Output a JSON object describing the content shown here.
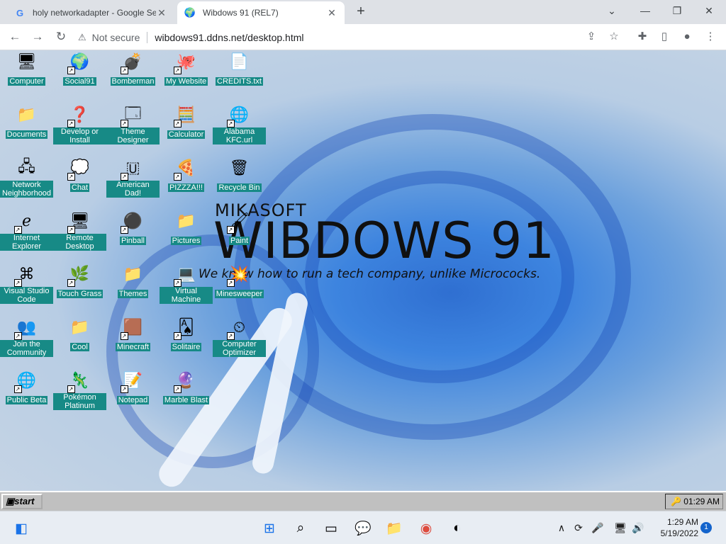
{
  "browser": {
    "tabs": [
      {
        "label": "holy networkadapter - Google Se",
        "icon": "google-icon",
        "active": false
      },
      {
        "label": "Wibdows 91 (REL7)",
        "icon": "globe-icon",
        "active": true
      }
    ],
    "security_label": "Not secure",
    "url": "wibdows91.ddns.net/desktop.html"
  },
  "desktop": {
    "brand_small": "MIKASOFT",
    "brand_large": "WIBDOWS 91",
    "tagline": "We know how to run a tech company, unlike Micrococks.",
    "icons": [
      {
        "label": "Computer",
        "icon": "computer-icon"
      },
      {
        "label": "Social91",
        "icon": "globe-icon"
      },
      {
        "label": "Bomberman",
        "icon": "bomberman-icon"
      },
      {
        "label": "My Website",
        "icon": "github-icon"
      },
      {
        "label": "CREDITS.txt",
        "icon": "text-file-icon"
      },
      {
        "label": "Documents",
        "icon": "folder-icon"
      },
      {
        "label": "Develop or Install",
        "icon": "help-icon"
      },
      {
        "label": "Theme Designer",
        "icon": "window-icon"
      },
      {
        "label": "Calculator",
        "icon": "calculator-icon"
      },
      {
        "label": "Alabama KFC.url",
        "icon": "internet-shortcut-icon"
      },
      {
        "label": "Network Neighborhood",
        "icon": "network-icon"
      },
      {
        "label": "Chat",
        "icon": "chat-bubble-icon"
      },
      {
        "label": "American Dad!",
        "icon": "flag-icon"
      },
      {
        "label": "PIZZZA!!!",
        "icon": "pizza-icon"
      },
      {
        "label": "Recycle Bin",
        "icon": "recycle-bin-icon"
      },
      {
        "label": "Internet Explorer",
        "icon": "internet-explorer-icon"
      },
      {
        "label": "Remote Desktop",
        "icon": "remote-desktop-icon"
      },
      {
        "label": "Pinball",
        "icon": "pinball-icon"
      },
      {
        "label": "Pictures",
        "icon": "folder-icon"
      },
      {
        "label": "Paint",
        "icon": "paint-icon"
      },
      {
        "label": "Visual Studio Code",
        "icon": "vscode-icon"
      },
      {
        "label": "Touch Grass",
        "icon": "grass-icon"
      },
      {
        "label": "Themes",
        "icon": "folder-icon"
      },
      {
        "label": "Virtual Machine",
        "icon": "virtual-machine-icon"
      },
      {
        "label": "Minesweeper",
        "icon": "mine-icon"
      },
      {
        "label": "Join the Community",
        "icon": "people-icon"
      },
      {
        "label": "Cool",
        "icon": "folder-icon"
      },
      {
        "label": "Minecraft",
        "icon": "minecraft-icon"
      },
      {
        "label": "Solitaire",
        "icon": "cards-icon"
      },
      {
        "label": "Computer Optimizer",
        "icon": "gauge-icon"
      },
      {
        "label": "Public Beta",
        "icon": "windows-globe-icon"
      },
      {
        "label": "Pokémon Platinum",
        "icon": "pokemon-icon"
      },
      {
        "label": "Notepad",
        "icon": "notepad-icon"
      },
      {
        "label": "Marble Blast",
        "icon": "marble-icon"
      }
    ]
  },
  "win91_taskbar": {
    "start_label": "start",
    "clock": "01:29 AM"
  },
  "win11_taskbar": {
    "time": "1:29 AM",
    "date": "5/19/2022",
    "notification_count": "1"
  },
  "colors": {
    "icon_label_bg": "#178a86",
    "taskbar_gray": "#c0c0c0",
    "win_blue": "#1464cc"
  }
}
